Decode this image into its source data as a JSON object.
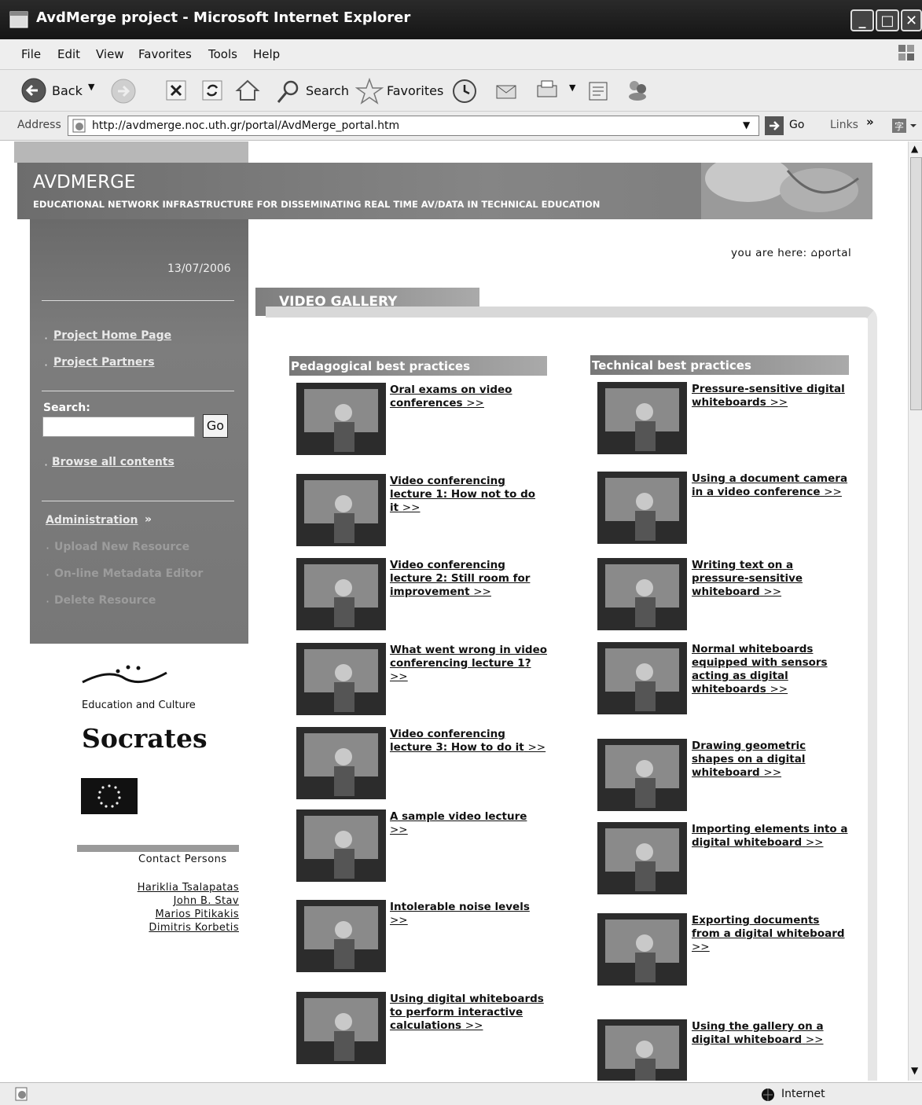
{
  "window": {
    "title": "AvdMerge project - Microsoft Internet Explorer"
  },
  "menu": [
    "File",
    "Edit",
    "View",
    "Favorites",
    "Tools",
    "Help"
  ],
  "toolbar": {
    "back_label": "Back",
    "search_label": "Search",
    "favorites_label": "Favorites"
  },
  "address": {
    "label": "Address",
    "url": "http://avdmerge.noc.uth.gr/portal/AvdMerge_portal.htm",
    "go_label": "Go",
    "links_label": "Links"
  },
  "header": {
    "title": "AVDMERGE",
    "subtitle": "EDUCATIONAL NETWORK INFRASTRUCTURE FOR DISSEMINATING REAL TIME AV/DATA IN TECHNICAL EDUCATION"
  },
  "sidebar": {
    "date": "13/07/2006",
    "links": [
      "Project Home Page",
      "Project Partners"
    ],
    "search_label": "Search:",
    "search_value": "",
    "search_go": "Go",
    "browse": "Browse all contents",
    "admin": "Administration",
    "admin_arrow": "»",
    "admin_items": [
      "Upload New Resource",
      "On-line Metadata Editor",
      "Delete Resource"
    ]
  },
  "breadcrumb": {
    "prefix": "you are here:",
    "current": "portal"
  },
  "gallery": {
    "title": "VIDEO GALLERY",
    "pedagogical": {
      "heading": "Pedagogical best practices",
      "items": [
        "Oral exams on video conferences",
        "Video conferencing lecture 1: How not to do it",
        "Video conferencing lecture 2: Still room for improvement",
        "What went wrong in video conferencing lecture 1?",
        "Video conferencing lecture 3: How to do it",
        "A sample video lecture",
        "Intolerable noise levels",
        "Using digital whiteboards to perform interactive calculations"
      ]
    },
    "technical": {
      "heading": "Technical best practices",
      "items": [
        "Pressure-sensitive digital whiteboards",
        "Using a document camera in a video conference",
        "Writing text on a pressure-sensitive whiteboard",
        "Normal whiteboards equipped with sensors acting as digital whiteboards",
        "Drawing geometric shapes on a digital whiteboard",
        "Importing elements into a digital whiteboard",
        "Exporting documents from a digital whiteboard",
        "Using the gallery on a digital whiteboard"
      ]
    },
    "more": ">>"
  },
  "footer_left": {
    "ec_label": "Education and Culture",
    "socrates": "Socrates",
    "contact_title": "Contact Persons",
    "contacts": [
      "Hariklia Tsalapatas",
      "John B. Stav",
      "Marios Pitikakis",
      "Dimitris Korbetis"
    ]
  },
  "status": {
    "zone": "Internet"
  },
  "colors": {
    "sidebar": "#6e6e6e",
    "header": "#7a7a7a",
    "heading_bar": "#9a9a9a",
    "titlebar": "#1e1e1e"
  }
}
